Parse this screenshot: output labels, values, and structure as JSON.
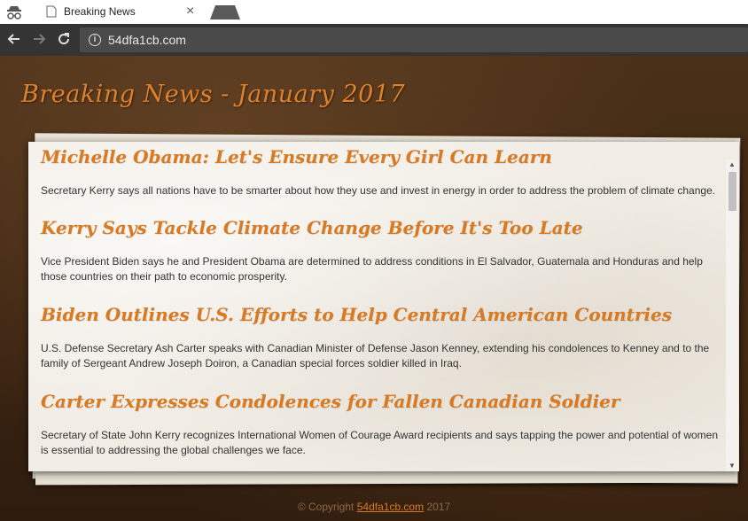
{
  "browser": {
    "tab_title": "Breaking News",
    "tab_close": "×",
    "url": "54dfa1cb.com"
  },
  "page": {
    "title": "Breaking News - January 2017",
    "articles": [
      {
        "title": "Michelle Obama: Let's Ensure Every Girl Can Learn",
        "text": "Secretary Kerry says all nations have to be smarter about how they use and invest in energy in order to address the problem of climate change."
      },
      {
        "title": "Kerry Says Tackle Climate Change Before It's Too Late",
        "text": "Vice President Biden says he and President Obama are determined to address conditions in El Salvador, Guatemala and Honduras and help those countries on their path to economic prosperity."
      },
      {
        "title": "Biden Outlines U.S. Efforts to Help Central American Countries",
        "text": "U.S. Defense Secretary Ash Carter speaks with Canadian Minister of Defense Jason Kenney, extending his condolences to Kenney and to the family of Sergeant Andrew Joseph Doiron, a Canadian special forces soldier killed in Iraq."
      },
      {
        "title": "Carter Expresses Condolences for Fallen Canadian Soldier",
        "text": "Secretary of State John Kerry recognizes International Women of Courage Award recipients and says tapping the power and potential of women is essential to addressing the global challenges we face."
      }
    ],
    "footer": {
      "prefix": "© Copyright",
      "link": "54dfa1cb.com",
      "year": "2017"
    }
  },
  "colors": {
    "accent": "#d97a22",
    "background": "#3a2614"
  }
}
